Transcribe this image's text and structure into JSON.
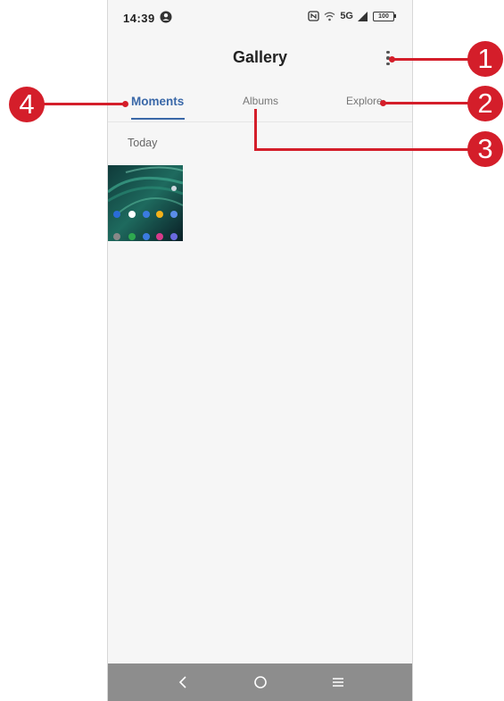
{
  "status_bar": {
    "time": "14:39",
    "network": "5G",
    "battery": "100"
  },
  "app_bar": {
    "title": "Gallery"
  },
  "tabs": [
    {
      "label": "Moments",
      "selected": true
    },
    {
      "label": "Albums",
      "selected": false
    },
    {
      "label": "Explore",
      "selected": false
    }
  ],
  "section": {
    "label": "Today"
  },
  "callouts": [
    "1",
    "2",
    "3",
    "4"
  ],
  "colors": {
    "accent": "#3a68a8",
    "callout": "#d41e2a",
    "nav_bar": "#8d8d8d"
  },
  "icons": {
    "status_avatar": "account-circle-icon",
    "nfc": "nfc-icon",
    "wifi": "wifi-icon",
    "signal": "signal-icon",
    "menu": "more-vertical-icon",
    "nav_back": "back-icon",
    "nav_home": "home-icon",
    "nav_recent": "menu-lines-icon"
  }
}
